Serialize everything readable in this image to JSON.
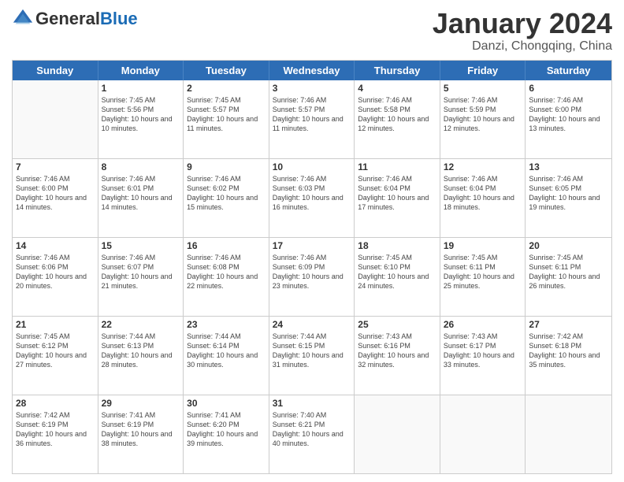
{
  "header": {
    "logo_general": "General",
    "logo_blue": "Blue",
    "month_title": "January 2024",
    "location": "Danzi, Chongqing, China"
  },
  "day_headers": [
    "Sunday",
    "Monday",
    "Tuesday",
    "Wednesday",
    "Thursday",
    "Friday",
    "Saturday"
  ],
  "weeks": [
    [
      {
        "day": "",
        "sunrise": "",
        "sunset": "",
        "daylight": ""
      },
      {
        "day": "1",
        "sunrise": "Sunrise: 7:45 AM",
        "sunset": "Sunset: 5:56 PM",
        "daylight": "Daylight: 10 hours and 10 minutes."
      },
      {
        "day": "2",
        "sunrise": "Sunrise: 7:45 AM",
        "sunset": "Sunset: 5:57 PM",
        "daylight": "Daylight: 10 hours and 11 minutes."
      },
      {
        "day": "3",
        "sunrise": "Sunrise: 7:46 AM",
        "sunset": "Sunset: 5:57 PM",
        "daylight": "Daylight: 10 hours and 11 minutes."
      },
      {
        "day": "4",
        "sunrise": "Sunrise: 7:46 AM",
        "sunset": "Sunset: 5:58 PM",
        "daylight": "Daylight: 10 hours and 12 minutes."
      },
      {
        "day": "5",
        "sunrise": "Sunrise: 7:46 AM",
        "sunset": "Sunset: 5:59 PM",
        "daylight": "Daylight: 10 hours and 12 minutes."
      },
      {
        "day": "6",
        "sunrise": "Sunrise: 7:46 AM",
        "sunset": "Sunset: 6:00 PM",
        "daylight": "Daylight: 10 hours and 13 minutes."
      }
    ],
    [
      {
        "day": "7",
        "sunrise": "Sunrise: 7:46 AM",
        "sunset": "Sunset: 6:00 PM",
        "daylight": "Daylight: 10 hours and 14 minutes."
      },
      {
        "day": "8",
        "sunrise": "Sunrise: 7:46 AM",
        "sunset": "Sunset: 6:01 PM",
        "daylight": "Daylight: 10 hours and 14 minutes."
      },
      {
        "day": "9",
        "sunrise": "Sunrise: 7:46 AM",
        "sunset": "Sunset: 6:02 PM",
        "daylight": "Daylight: 10 hours and 15 minutes."
      },
      {
        "day": "10",
        "sunrise": "Sunrise: 7:46 AM",
        "sunset": "Sunset: 6:03 PM",
        "daylight": "Daylight: 10 hours and 16 minutes."
      },
      {
        "day": "11",
        "sunrise": "Sunrise: 7:46 AM",
        "sunset": "Sunset: 6:04 PM",
        "daylight": "Daylight: 10 hours and 17 minutes."
      },
      {
        "day": "12",
        "sunrise": "Sunrise: 7:46 AM",
        "sunset": "Sunset: 6:04 PM",
        "daylight": "Daylight: 10 hours and 18 minutes."
      },
      {
        "day": "13",
        "sunrise": "Sunrise: 7:46 AM",
        "sunset": "Sunset: 6:05 PM",
        "daylight": "Daylight: 10 hours and 19 minutes."
      }
    ],
    [
      {
        "day": "14",
        "sunrise": "Sunrise: 7:46 AM",
        "sunset": "Sunset: 6:06 PM",
        "daylight": "Daylight: 10 hours and 20 minutes."
      },
      {
        "day": "15",
        "sunrise": "Sunrise: 7:46 AM",
        "sunset": "Sunset: 6:07 PM",
        "daylight": "Daylight: 10 hours and 21 minutes."
      },
      {
        "day": "16",
        "sunrise": "Sunrise: 7:46 AM",
        "sunset": "Sunset: 6:08 PM",
        "daylight": "Daylight: 10 hours and 22 minutes."
      },
      {
        "day": "17",
        "sunrise": "Sunrise: 7:46 AM",
        "sunset": "Sunset: 6:09 PM",
        "daylight": "Daylight: 10 hours and 23 minutes."
      },
      {
        "day": "18",
        "sunrise": "Sunrise: 7:45 AM",
        "sunset": "Sunset: 6:10 PM",
        "daylight": "Daylight: 10 hours and 24 minutes."
      },
      {
        "day": "19",
        "sunrise": "Sunrise: 7:45 AM",
        "sunset": "Sunset: 6:11 PM",
        "daylight": "Daylight: 10 hours and 25 minutes."
      },
      {
        "day": "20",
        "sunrise": "Sunrise: 7:45 AM",
        "sunset": "Sunset: 6:11 PM",
        "daylight": "Daylight: 10 hours and 26 minutes."
      }
    ],
    [
      {
        "day": "21",
        "sunrise": "Sunrise: 7:45 AM",
        "sunset": "Sunset: 6:12 PM",
        "daylight": "Daylight: 10 hours and 27 minutes."
      },
      {
        "day": "22",
        "sunrise": "Sunrise: 7:44 AM",
        "sunset": "Sunset: 6:13 PM",
        "daylight": "Daylight: 10 hours and 28 minutes."
      },
      {
        "day": "23",
        "sunrise": "Sunrise: 7:44 AM",
        "sunset": "Sunset: 6:14 PM",
        "daylight": "Daylight: 10 hours and 30 minutes."
      },
      {
        "day": "24",
        "sunrise": "Sunrise: 7:44 AM",
        "sunset": "Sunset: 6:15 PM",
        "daylight": "Daylight: 10 hours and 31 minutes."
      },
      {
        "day": "25",
        "sunrise": "Sunrise: 7:43 AM",
        "sunset": "Sunset: 6:16 PM",
        "daylight": "Daylight: 10 hours and 32 minutes."
      },
      {
        "day": "26",
        "sunrise": "Sunrise: 7:43 AM",
        "sunset": "Sunset: 6:17 PM",
        "daylight": "Daylight: 10 hours and 33 minutes."
      },
      {
        "day": "27",
        "sunrise": "Sunrise: 7:42 AM",
        "sunset": "Sunset: 6:18 PM",
        "daylight": "Daylight: 10 hours and 35 minutes."
      }
    ],
    [
      {
        "day": "28",
        "sunrise": "Sunrise: 7:42 AM",
        "sunset": "Sunset: 6:19 PM",
        "daylight": "Daylight: 10 hours and 36 minutes."
      },
      {
        "day": "29",
        "sunrise": "Sunrise: 7:41 AM",
        "sunset": "Sunset: 6:19 PM",
        "daylight": "Daylight: 10 hours and 38 minutes."
      },
      {
        "day": "30",
        "sunrise": "Sunrise: 7:41 AM",
        "sunset": "Sunset: 6:20 PM",
        "daylight": "Daylight: 10 hours and 39 minutes."
      },
      {
        "day": "31",
        "sunrise": "Sunrise: 7:40 AM",
        "sunset": "Sunset: 6:21 PM",
        "daylight": "Daylight: 10 hours and 40 minutes."
      },
      {
        "day": "",
        "sunrise": "",
        "sunset": "",
        "daylight": ""
      },
      {
        "day": "",
        "sunrise": "",
        "sunset": "",
        "daylight": ""
      },
      {
        "day": "",
        "sunrise": "",
        "sunset": "",
        "daylight": ""
      }
    ]
  ]
}
